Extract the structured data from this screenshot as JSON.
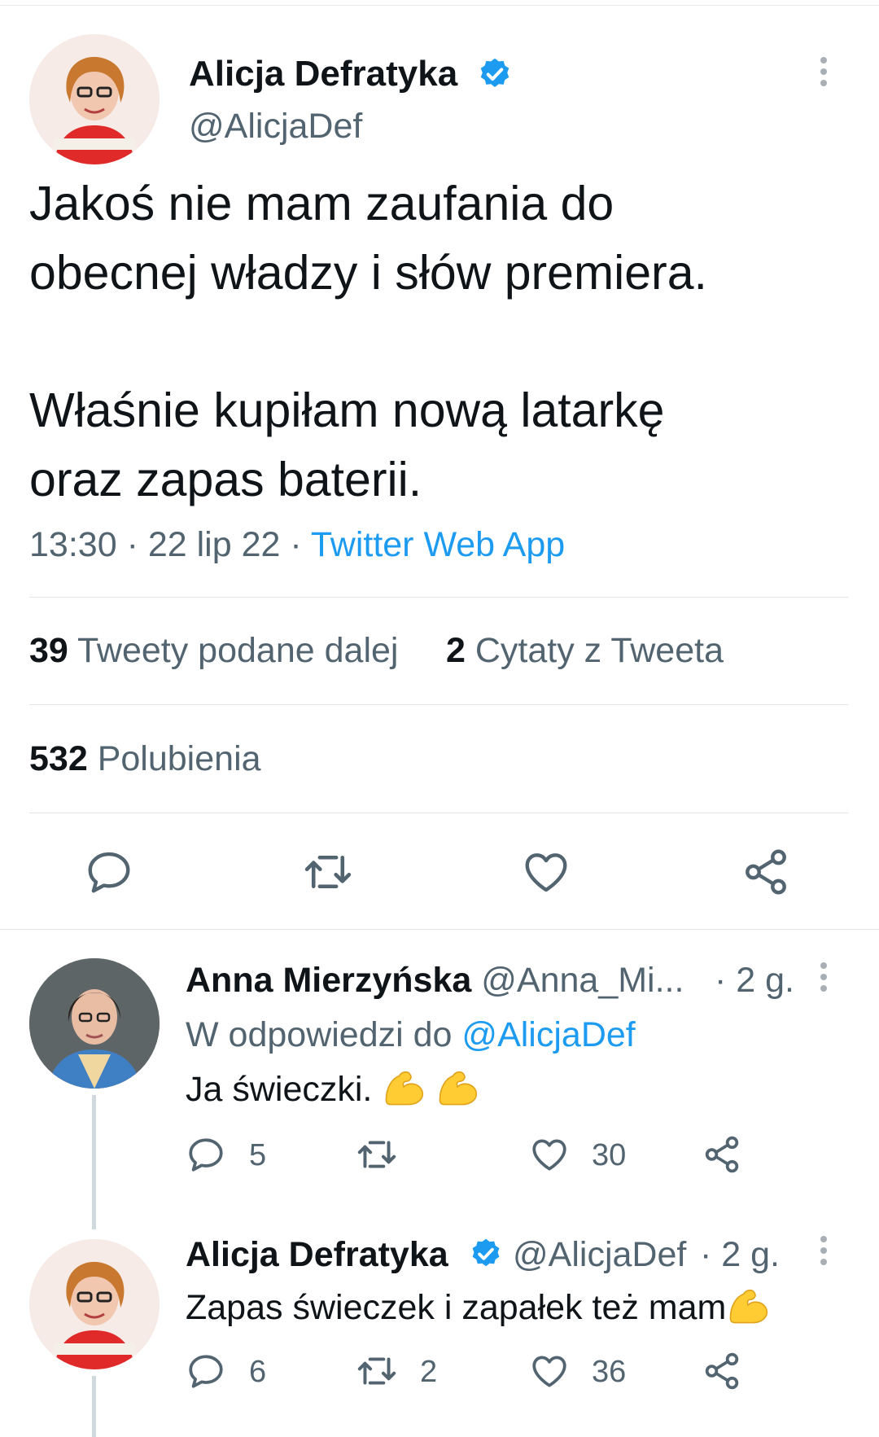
{
  "main_tweet": {
    "author_name": "Alicja Defratyka",
    "author_handle": "@AlicjaDef",
    "text_p1": "Jakoś nie mam zaufania do\nobecnej władzy i słów premiera.",
    "text_p2": "Właśnie kupiłam nową latarkę\noraz zapas baterii.",
    "time": "13:30",
    "date": "22 lip 22",
    "separator": "·",
    "source": "Twitter Web App",
    "retweets_count": "39",
    "retweets_label": "Tweety podane dalej",
    "quotes_count": "2",
    "quotes_label": "Cytaty z Tweeta",
    "likes_count": "532",
    "likes_label": "Polubienia"
  },
  "replies": [
    {
      "author_name": "Anna Mierzyńska",
      "author_handle": "@Anna_Mi...",
      "time": "· 2 g.",
      "reply_to_label": "W odpowiedzi do",
      "reply_to_handle": "@AlicjaDef",
      "text": "Ja świeczki.",
      "replies_count": "5",
      "retweets_count": "",
      "likes_count": "30"
    },
    {
      "author_name": "Alicja Defratyka",
      "author_handle": "@AlicjaDef",
      "time": "· 2 g.",
      "text": "Zapas świeczek i zapałek też mam",
      "replies_count": "6",
      "retweets_count": "2",
      "likes_count": "36"
    }
  ],
  "icons": [
    "verified-badge-icon",
    "more-options-icon",
    "reply-icon",
    "retweet-icon",
    "like-icon",
    "share-icon",
    "flexed-biceps-emoji"
  ],
  "colors": {
    "accent": "#1d9bf0",
    "text": "#0f1419",
    "secondary": "#536471",
    "divider": "#e1e6e9",
    "emoji": "#ffcc33"
  }
}
